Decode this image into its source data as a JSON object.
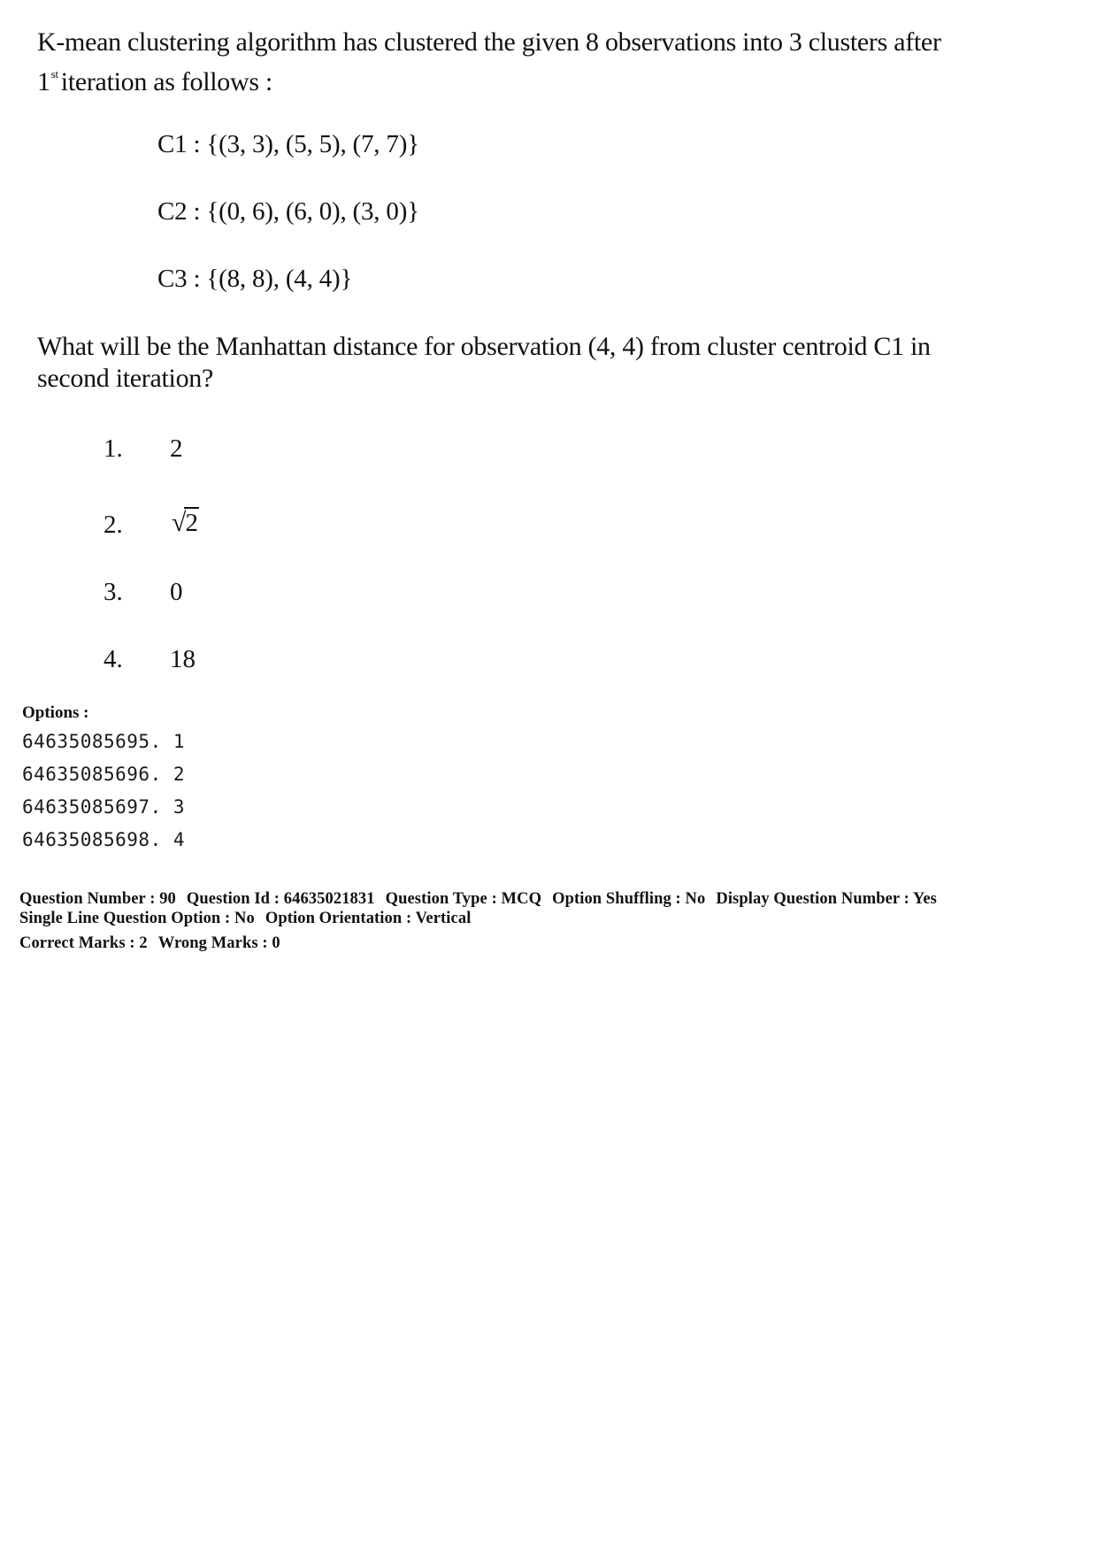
{
  "question": {
    "intro_line1": "K-mean clustering algorithm has clustered the given 8 observations into 3 clusters after",
    "intro_line2_prefix": "1",
    "intro_line2_sup": "st",
    "intro_line2_rest": "iteration as follows :",
    "clusters": [
      {
        "label": "C1",
        "points": "C1 : {(3, 3), (5, 5), (7, 7)}"
      },
      {
        "label": "C2",
        "points": "C2 : {(0, 6), (6, 0), (3, 0)}"
      },
      {
        "label": "C3",
        "points": "C3 : {(8, 8), (4, 4)}"
      }
    ],
    "prompt_line1": "What will be the Manhattan distance for observation (4, 4) from cluster centroid C1 in",
    "prompt_line2": "second iteration?",
    "choices": [
      {
        "num": "1.",
        "value": "2"
      },
      {
        "num": "2.",
        "value_symbol": "√",
        "value": "2"
      },
      {
        "num": "3.",
        "value": "0"
      },
      {
        "num": "4.",
        "value": "18"
      }
    ]
  },
  "options": {
    "label": "Options :",
    "items": [
      "64635085695. 1",
      "64635085696. 2",
      "64635085697. 3",
      "64635085698. 4"
    ]
  },
  "meta": {
    "question_number": "Question Number : 90",
    "question_id": "Question Id : 64635021831",
    "question_type": "Question Type : MCQ",
    "option_shuffling": "Option Shuffling : No",
    "display_question_number": "Display Question Number : Yes",
    "single_line_option": "Single Line Question Option : No",
    "option_orientation": "Option Orientation : Vertical",
    "correct_marks": "Correct Marks : 2",
    "wrong_marks": "Wrong Marks : 0"
  }
}
